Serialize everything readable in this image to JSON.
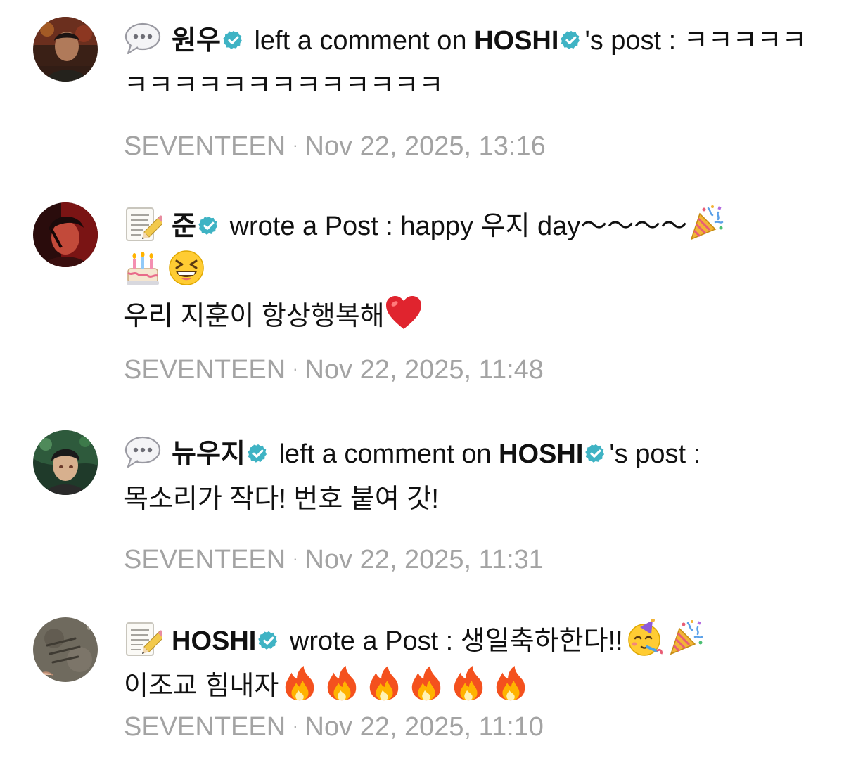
{
  "colors": {
    "badge": "#3fb3c4",
    "meta_text": "#a3a3a3",
    "body_text": "#111111"
  },
  "feed": [
    {
      "type_icon": "speech-bubble-icon",
      "author": "원우",
      "verb": " left a comment on ",
      "target": "HOSHI",
      "target_suffix": "'s post : ",
      "body": "ㅋㅋㅋㅋㅋㅋㅋㅋㅋㅋㅋㅋㅋㅋㅋㅋㅋㅋ",
      "group": "SEVENTEEN",
      "separator": "·",
      "time": "Nov 22, 2025, 13:16"
    },
    {
      "type_icon": "memo-pencil-icon",
      "author": "준",
      "verb": " wrote a Post : ",
      "body_line1": "happy 우지 day～～～～",
      "body_line3": "우리 지훈이 항상행복해",
      "emojis": [
        "party-popper-icon",
        "birthday-cake-icon",
        "grinning-squinting-face-icon",
        "red-heart-icon"
      ],
      "group": "SEVENTEEN",
      "separator": "·",
      "time": "Nov 22, 2025, 11:48"
    },
    {
      "type_icon": "speech-bubble-icon",
      "author": "뉴우지",
      "verb": " left a comment on ",
      "target": "HOSHI",
      "target_suffix": "'s post :",
      "body": "목소리가 작다! 번호 붙여 갓!",
      "group": "SEVENTEEN",
      "separator": "·",
      "time": "Nov 22, 2025, 11:31"
    },
    {
      "type_icon": "memo-pencil-icon",
      "author": "HOSHI",
      "verb": " wrote a Post : ",
      "body_line1": "생일축하한다!!",
      "body_line2": "이조교 힘내자",
      "emojis": [
        "partying-face-icon",
        "party-popper-icon",
        "fire-icon"
      ],
      "group": "SEVENTEEN",
      "separator": "·",
      "time": "Nov 22, 2025, 11:10"
    }
  ]
}
